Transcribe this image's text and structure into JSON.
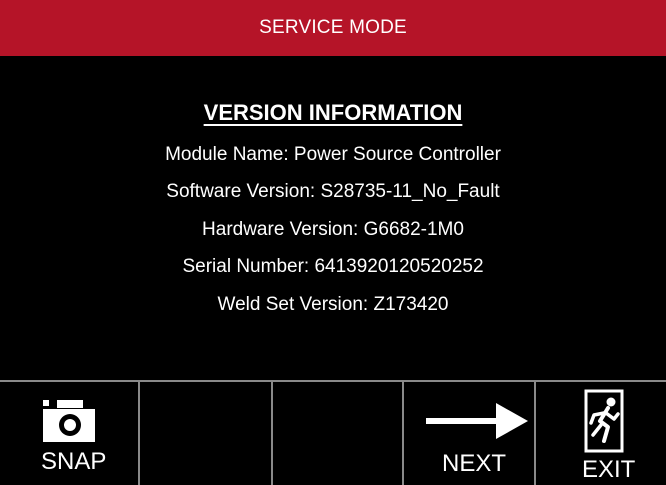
{
  "header": {
    "title": "SERVICE MODE"
  },
  "version_info": {
    "heading": "VERSION INFORMATION",
    "lines": [
      "Module Name: Power Source Controller",
      "Software Version: S28735-11_No_Fault",
      "Hardware Version: G6682-1M0",
      "Serial Number: 6413920120520252",
      "Weld Set Version: Z173420"
    ]
  },
  "toolbar": {
    "buttons": [
      {
        "label": "SNAP",
        "icon": "camera-icon"
      },
      {
        "label": "",
        "icon": ""
      },
      {
        "label": "",
        "icon": ""
      },
      {
        "label": "NEXT",
        "icon": "arrow-right-icon"
      },
      {
        "label": "EXIT",
        "icon": "exit-door-icon"
      }
    ]
  },
  "colors": {
    "header_bg": "#b51428",
    "background": "#000000",
    "text": "#ffffff",
    "divider": "#8a8a8a"
  }
}
